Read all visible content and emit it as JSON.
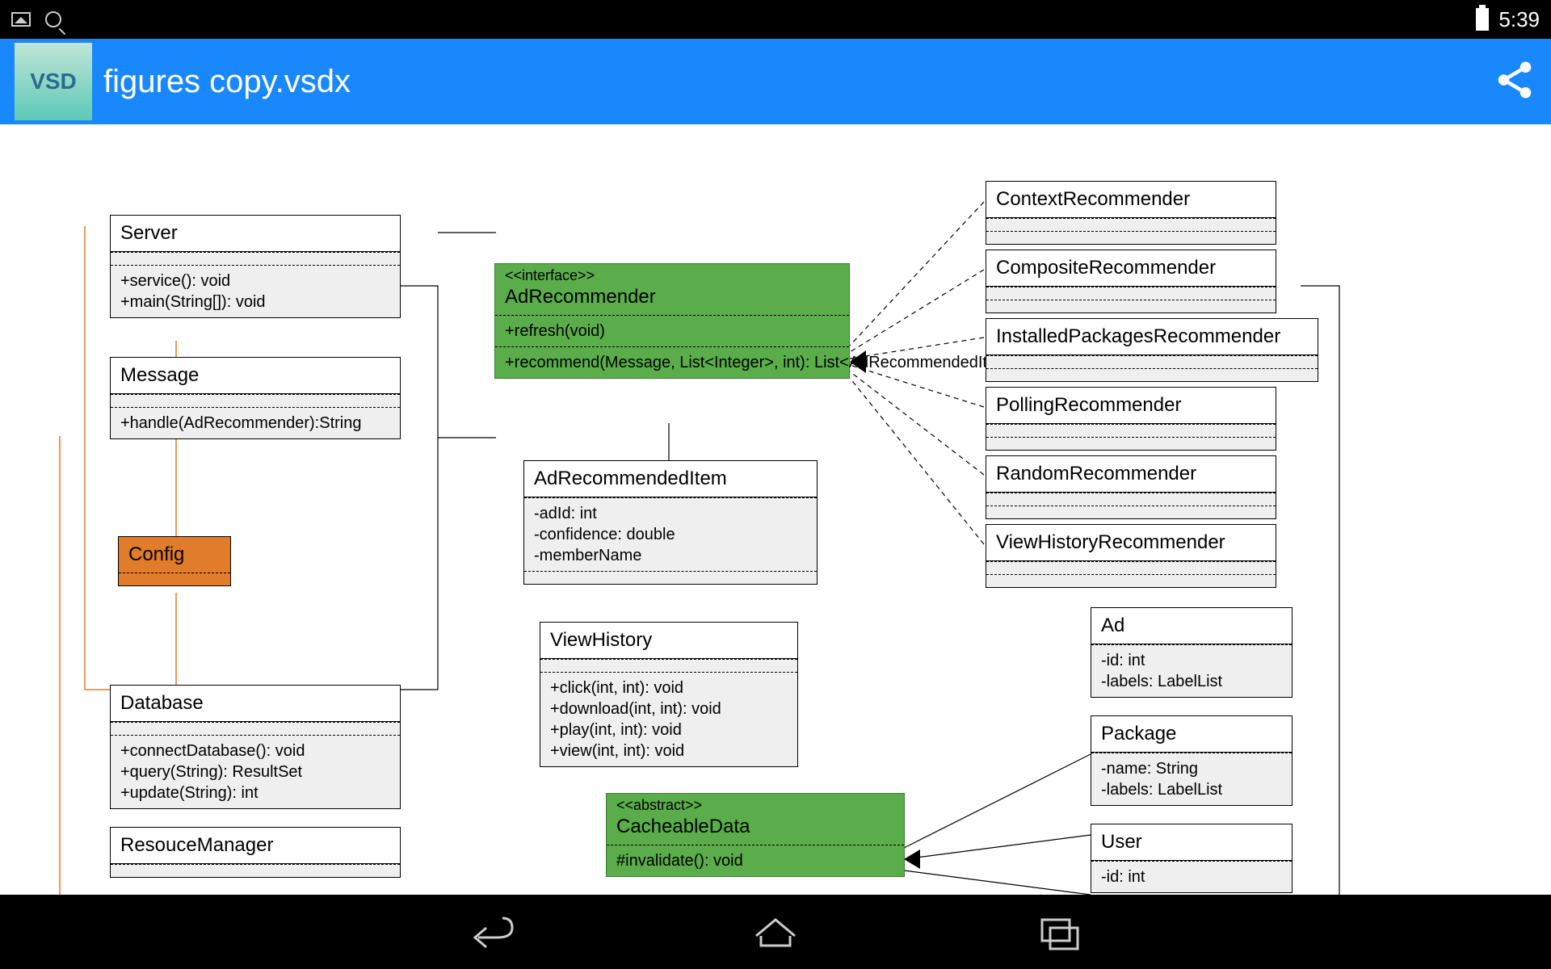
{
  "status": {
    "time": "5:39"
  },
  "app": {
    "title": "figures copy.vsdx",
    "logo_text": "VSD"
  },
  "boxes": {
    "server": {
      "title": "Server",
      "methods": [
        "+service(): void",
        "+main(String[]): void"
      ]
    },
    "message": {
      "title": "Message",
      "methods": [
        "+handle(AdRecommender):String"
      ]
    },
    "config": {
      "title": "Config"
    },
    "database": {
      "title": "Database",
      "methods": [
        "+connectDatabase(): void",
        "+query(String): ResultSet",
        "+update(String): int"
      ]
    },
    "resmgr": {
      "title": "ResouceManager"
    },
    "adrec": {
      "stereotype": "<<interface>>",
      "title": "AdRecommender",
      "methods": [
        "+refresh(void)",
        "+recommend(Message, List<Integer>, int): List<AdRecommendedItem>"
      ]
    },
    "adrecitem": {
      "title": "AdRecommendedItem",
      "attrs": [
        "-adId: int",
        "-confidence: double",
        "-memberName"
      ]
    },
    "viewhist": {
      "title": "ViewHistory",
      "methods": [
        "+click(int, int): void",
        "+download(int, int): void",
        "+play(int, int): void",
        "+view(int, int): void"
      ]
    },
    "cacheable": {
      "stereotype": "<<abstract>>",
      "title": "CacheableData",
      "methods": [
        "#invalidate(): void"
      ]
    },
    "contextrec": {
      "title": "ContextRecommender"
    },
    "compositerec": {
      "title": "CompositeRecommender"
    },
    "installedrec": {
      "title": "InstalledPackagesRecommender"
    },
    "pollingrec": {
      "title": "PollingRecommender"
    },
    "randomrec": {
      "title": "RandomRecommender"
    },
    "viewhistrec": {
      "title": "ViewHistoryRecommender"
    },
    "ad": {
      "title": "Ad",
      "attrs": [
        "-id: int",
        "-labels: LabelList"
      ]
    },
    "package": {
      "title": "Package",
      "attrs": [
        "-name: String",
        "-labels: LabelList"
      ]
    },
    "user": {
      "title": "User",
      "attrs": [
        "-id: int"
      ]
    }
  }
}
